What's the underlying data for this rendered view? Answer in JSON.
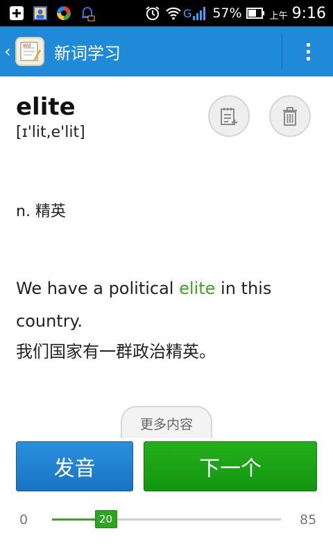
{
  "status_bar": {
    "battery_percent": "57%",
    "ampm": "上午",
    "time": "9:16",
    "network_label": "G",
    "icons": [
      "add-app-icon",
      "contacts-icon",
      "browser-icon",
      "notification-icon",
      "alarm-icon",
      "wifi-icon",
      "signal-icon",
      "battery-icon"
    ]
  },
  "app_bar": {
    "title": "新词学习"
  },
  "word": {
    "text": "elite",
    "phonetic": "[ɪ'lit,e'lit]"
  },
  "definition": "n. 精英",
  "example": {
    "before": "We have a political ",
    "highlight": "elite",
    "after": " in this country.",
    "translation": "我们国家有一群政治精英。"
  },
  "more_button": "更多内容",
  "buttons": {
    "pronounce": "发音",
    "next": "下一个"
  },
  "progress": {
    "min": "0",
    "max": "85",
    "current": "20",
    "fraction": 0.235
  },
  "colors": {
    "app_bar": "#1f8ad8",
    "accent_green": "#3aa620",
    "pronounce_button": "#1f80d0",
    "next_button": "#1ca316"
  }
}
